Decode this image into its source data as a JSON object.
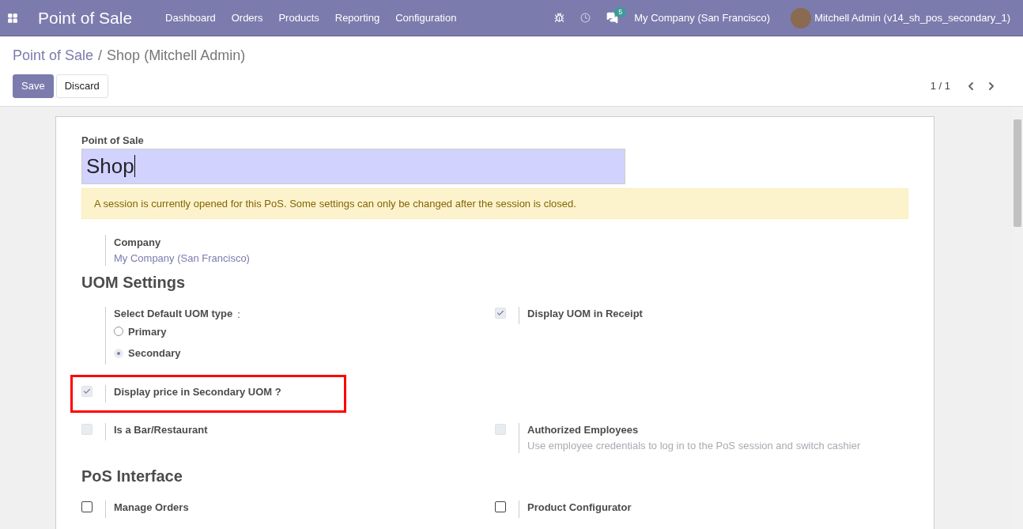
{
  "navbar": {
    "app_title": "Point of Sale",
    "menu": [
      "Dashboard",
      "Orders",
      "Products",
      "Reporting",
      "Configuration"
    ],
    "notification_count": "5",
    "company": "My Company (San Francisco)",
    "user": "Mitchell Admin (v14_sh_pos_secondary_1)"
  },
  "breadcrumb": {
    "parent": "Point of Sale",
    "separator": "/",
    "current": "Shop (Mitchell Admin)"
  },
  "buttons": [
    {
      "label": "Save",
      "kind": "primary"
    },
    {
      "label": "Discard",
      "kind": "secondary"
    }
  ],
  "pager": "1 / 1",
  "form": {
    "name_label": "Point of Sale",
    "name_value": "Shop",
    "alert": "A session is currently opened for this PoS. Some settings can only be changed after the session is closed.",
    "company_label": "Company",
    "company_value": "My Company (San Francisco)",
    "sections": [
      {
        "title": "UOM Settings",
        "rows": [
          [
            {
              "kind": "radio",
              "label": "Select Default UOM type",
              "suffix": ":",
              "options": [
                {
                  "label": "Primary",
                  "selected": false
                },
                {
                  "label": "Secondary",
                  "selected": true
                }
              ]
            },
            {
              "kind": "checkbox",
              "label": "Display UOM in Receipt",
              "checked": true,
              "disabled": true,
              "highlighted": false
            }
          ],
          [
            {
              "kind": "checkbox",
              "label": "Display price in Secondary UOM ?",
              "checked": true,
              "disabled": true,
              "highlighted": true
            },
            null
          ],
          [
            {
              "kind": "checkbox",
              "label": "Is a Bar/Restaurant",
              "checked": false,
              "disabled": true,
              "highlighted": false
            },
            {
              "kind": "checkbox",
              "label": "Authorized Employees",
              "description": "Use employee credentials to log in to the PoS session and switch cashier",
              "checked": false,
              "disabled": true,
              "highlighted": false
            }
          ]
        ]
      },
      {
        "title": "PoS Interface",
        "rows": [
          [
            {
              "kind": "checkbox",
              "label": "Manage Orders",
              "checked": false,
              "disabled": false,
              "highlighted": false
            },
            {
              "kind": "checkbox",
              "label": "Product Configurator",
              "checked": false,
              "disabled": false,
              "highlighted": false
            }
          ]
        ]
      }
    ]
  }
}
